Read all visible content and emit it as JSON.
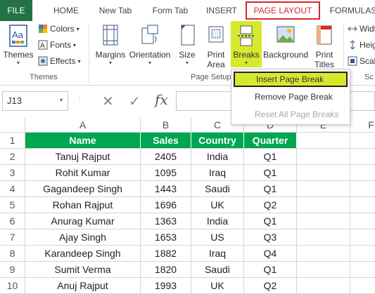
{
  "tabs": {
    "file": "FILE",
    "home": "HOME",
    "new_tab": "New Tab",
    "form_tab": "Form Tab",
    "insert": "INSERT",
    "page_layout": "PAGE LAYOUT",
    "formulas": "FORMULAS"
  },
  "ribbon": {
    "themes": "Themes",
    "colors": "Colors",
    "fonts": "Fonts",
    "effects": "Effects",
    "themes_group": "Themes",
    "margins": "Margins",
    "orientation": "Orientation",
    "size": "Size",
    "print_area_1": "Print",
    "print_area_2": "Area",
    "breaks": "Breaks",
    "background": "Background",
    "print_titles_1": "Print",
    "print_titles_2": "Titles",
    "page_setup_group": "Page Setup",
    "width": "Widt",
    "height": "Heig",
    "scale": "Scal",
    "sc_group": "Sc"
  },
  "breaks_menu": {
    "insert": "Insert Page Break",
    "remove": "Remove Page Break",
    "reset": "Reset All Page Breaks"
  },
  "formula_bar": {
    "name_box": "J13",
    "fx": "fx"
  },
  "columns": [
    "A",
    "B",
    "C",
    "D",
    "E",
    "F"
  ],
  "row_numbers": [
    "1",
    "2",
    "3",
    "4",
    "5",
    "6",
    "7",
    "8",
    "9",
    "10"
  ],
  "table": {
    "headers": [
      "Name",
      "Sales",
      "Country",
      "Quarter"
    ],
    "rows": [
      [
        "Tanuj Rajput",
        "2405",
        "India",
        "Q1"
      ],
      [
        "Rohit Kumar",
        "1095",
        "Iraq",
        "Q1"
      ],
      [
        "Gagandeep Singh",
        "1443",
        "Saudi",
        "Q1"
      ],
      [
        "Rohan Rajput",
        "1696",
        "UK",
        "Q2"
      ],
      [
        "Anurag Kumar",
        "1363",
        "India",
        "Q1"
      ],
      [
        "Ajay Singh",
        "1653",
        "US",
        "Q3"
      ],
      [
        "Karandeep Singh",
        "1882",
        "Iraq",
        "Q4"
      ],
      [
        "Sumit Verma",
        "1820",
        "Saudi",
        "Q1"
      ],
      [
        "Anuj Rajput",
        "1993",
        "UK",
        "Q2"
      ]
    ]
  },
  "colors": {
    "header_green": "#00a651",
    "file_green": "#217346",
    "highlight": "#d6e92f",
    "active_tab": "#d9262b"
  }
}
